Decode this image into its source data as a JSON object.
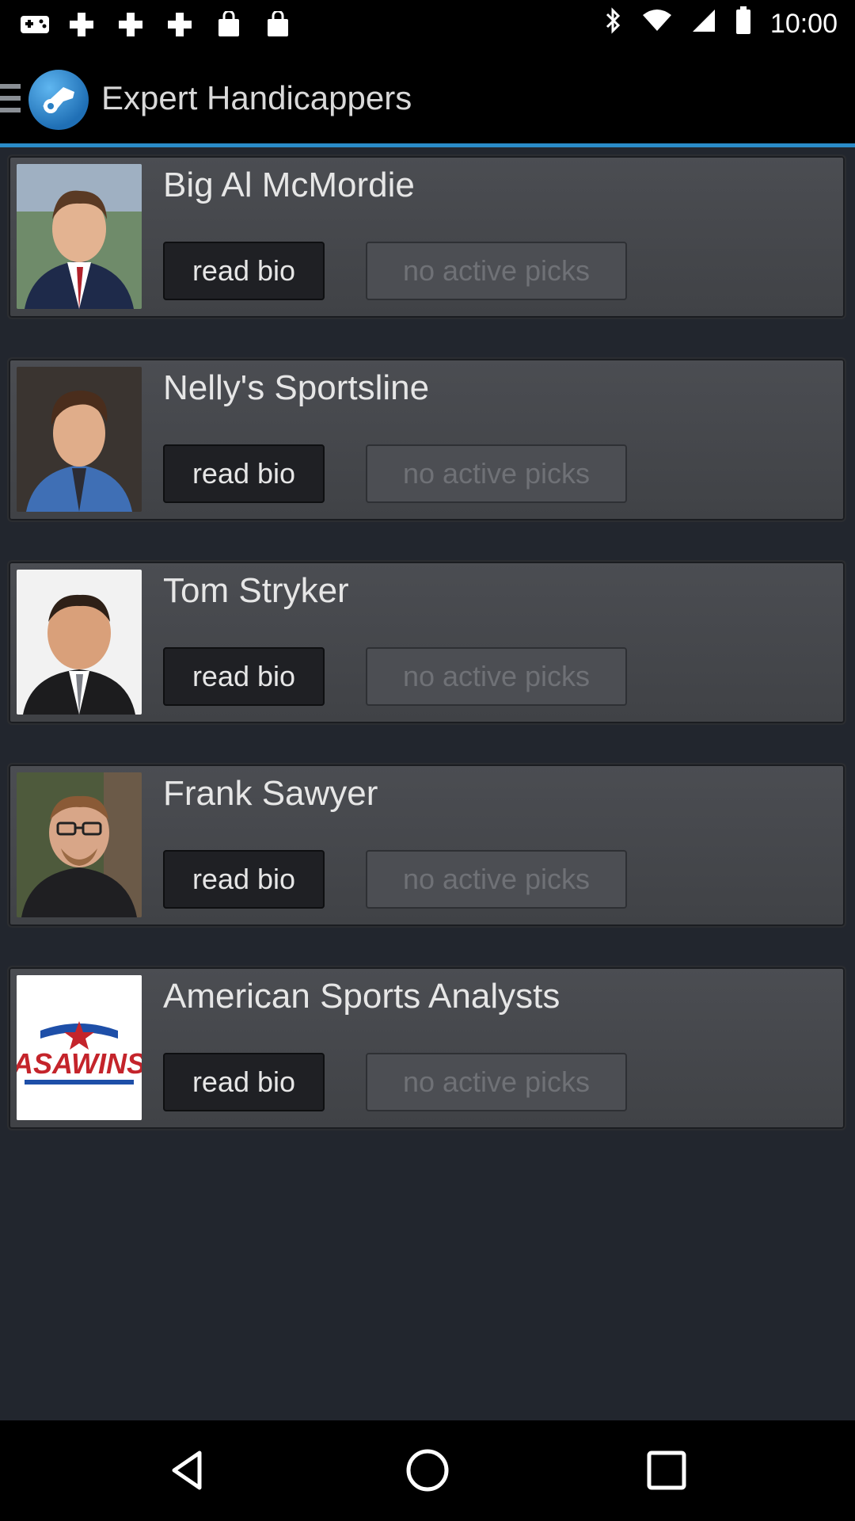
{
  "status_bar": {
    "time": "10:00"
  },
  "app_bar": {
    "title": "Expert Handicappers"
  },
  "handicappers": [
    {
      "name": "Big Al McMordie",
      "bio_label": "read bio",
      "picks_label": "no active picks"
    },
    {
      "name": "Nelly's Sportsline",
      "bio_label": "read bio",
      "picks_label": "no active picks"
    },
    {
      "name": "Tom Stryker",
      "bio_label": "read bio",
      "picks_label": "no active picks"
    },
    {
      "name": "Frank Sawyer",
      "bio_label": "read bio",
      "picks_label": "no active picks"
    },
    {
      "name": "American Sports Analysts",
      "bio_label": "read bio",
      "picks_label": "no active picks",
      "logo_text": "ASAWINS"
    }
  ],
  "colors": {
    "accent": "#2a8bc8",
    "background": "#22262e",
    "card": "#46484d"
  }
}
